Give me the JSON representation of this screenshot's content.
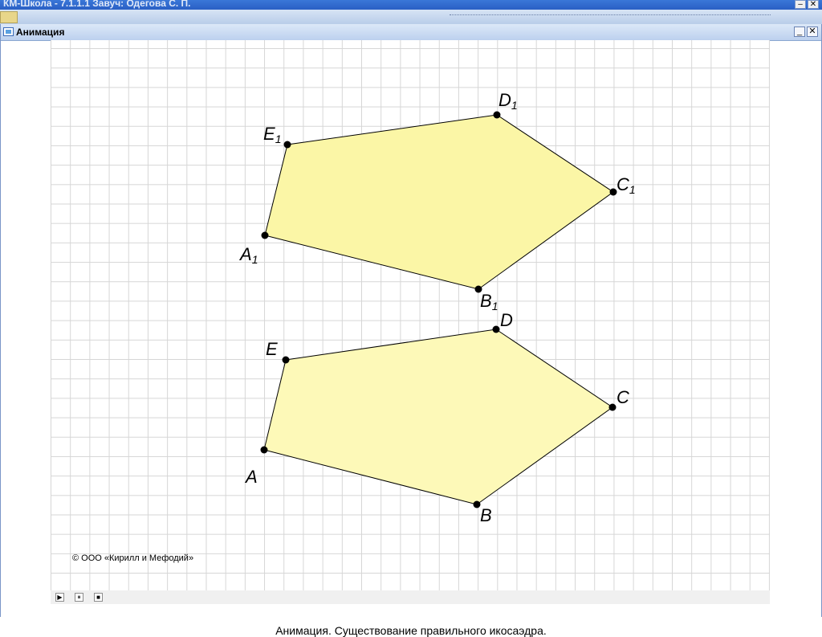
{
  "background_window": {
    "title": "КМ-Школа - 7.1.1.1 Завуч: Одегова С. П.",
    "controls": [
      "–",
      "✕"
    ]
  },
  "window": {
    "title": "Анимация",
    "icon": "animation-icon",
    "controls": [
      "_",
      "✕"
    ]
  },
  "figure": {
    "polygons": [
      {
        "name": "upper",
        "vertices": [
          "A1",
          "B1",
          "C1",
          "D1",
          "E1"
        ],
        "fill": "#fbf6a6"
      },
      {
        "name": "lower",
        "vertices": [
          "A",
          "B",
          "C",
          "D",
          "E"
        ],
        "fill": "#fdf9b8"
      }
    ],
    "labels": {
      "A1": {
        "letter": "A",
        "sub": "1"
      },
      "B1": {
        "letter": "B",
        "sub": "1"
      },
      "C1": {
        "letter": "C",
        "sub": "1"
      },
      "D1": {
        "letter": "D",
        "sub": "1"
      },
      "E1": {
        "letter": "E",
        "sub": "1"
      },
      "A": {
        "letter": "A",
        "sub": ""
      },
      "B": {
        "letter": "B",
        "sub": ""
      },
      "C": {
        "letter": "C",
        "sub": ""
      },
      "D": {
        "letter": "D",
        "sub": ""
      },
      "E": {
        "letter": "E",
        "sub": ""
      }
    }
  },
  "copyright": "© ООО «Кирилл и Мефодий»",
  "player": {
    "play": "▶",
    "pause": "⏸",
    "stop": "■"
  },
  "caption": "Анимация. Существование правильного икосаэдра."
}
